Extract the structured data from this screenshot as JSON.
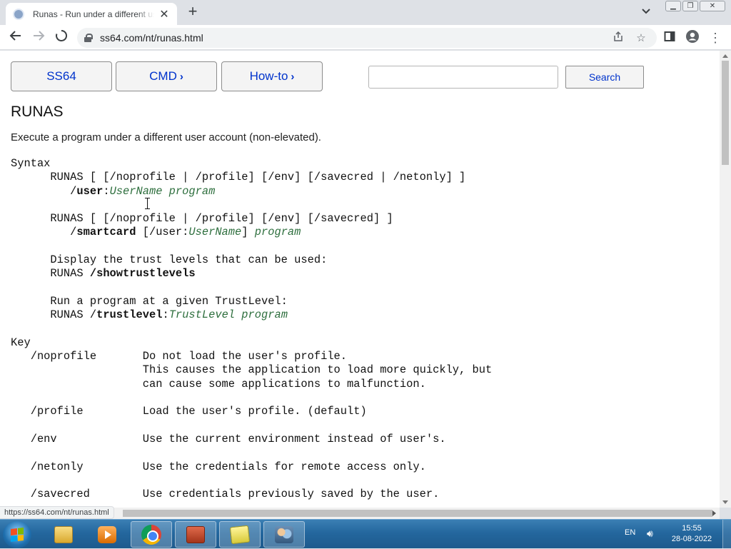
{
  "browser": {
    "tab_title": "Runas - Run under a different user",
    "tab_close": "✕",
    "new_tab": "+",
    "url": "ss64.com/nt/runas.html",
    "status_url": "https://ss64.com/nt/runas.html"
  },
  "nav": {
    "ss64_label": "SS64",
    "cmd_label": "CMD",
    "howto_label": "How-to",
    "search_value": "",
    "search_button": "Search"
  },
  "page": {
    "title": "RUNAS",
    "description": "Execute a program under a different user account (non-elevated)."
  },
  "syntax": {
    "heading": "Syntax",
    "l1": "      RUNAS [ [/noprofile | /profile] [/env] [/savecred | /netonly] ]",
    "l2_prefix": "         /",
    "l2_switch": "user",
    "l2_sep": ":",
    "l2_args": "UserName program",
    "l3": "      RUNAS [ [/noprofile | /profile] [/env] [/savecred] ]",
    "l4_prefix": "         /",
    "l4_switch": "smartcard",
    "l4_mid": " [/user:",
    "l4_user": "UserName",
    "l4_close": "] ",
    "l4_prog": "program",
    "l5": "      Display the trust levels that can be used:",
    "l6_prefix": "      RUNAS ",
    "l6_switch": "/showtrustlevels",
    "l7": "      Run a program at a given TrustLevel:",
    "l8_prefix": "      RUNAS /",
    "l8_switch": "trustlevel",
    "l8_sep": ":",
    "l8_args": "TrustLevel program"
  },
  "key": {
    "heading": "Key",
    "noprofile_1": "   /noprofile       Do not load the user's profile.",
    "noprofile_2": "                    This causes the application to load more quickly, but",
    "noprofile_3": "                    can cause some applications to malfunction.",
    "profile": "   /profile         Load the user's profile. (default)",
    "env": "   /env             Use the current environment instead of user's.",
    "netonly": "   /netonly         Use the credentials for remote access only.",
    "savecred": "   /savecred        Use credentials previously saved by the user."
  },
  "tray": {
    "lang": "EN",
    "time": "15:55",
    "date": "28-08-2022"
  }
}
